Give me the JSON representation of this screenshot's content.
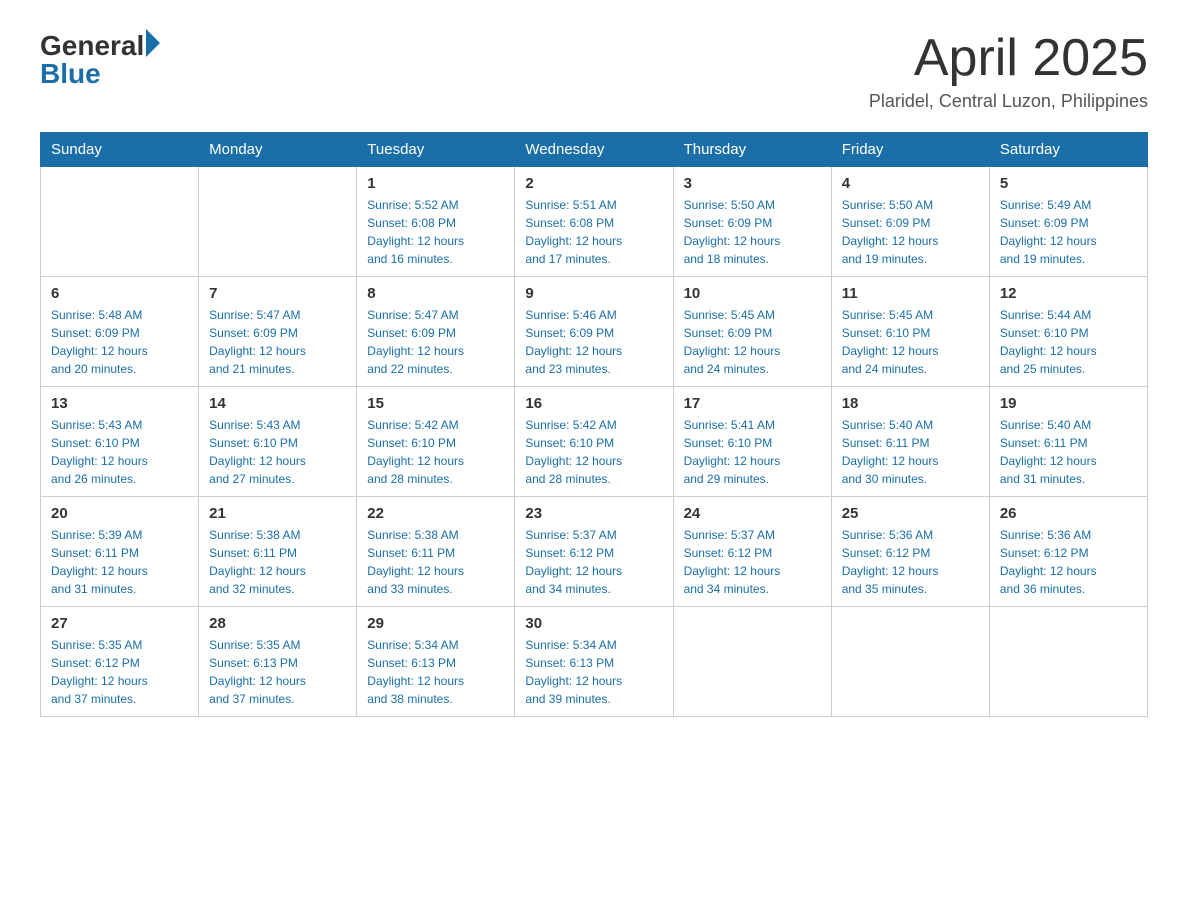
{
  "header": {
    "logo_general": "General",
    "logo_blue": "Blue",
    "month_year": "April 2025",
    "location": "Plaridel, Central Luzon, Philippines"
  },
  "days_of_week": [
    "Sunday",
    "Monday",
    "Tuesday",
    "Wednesday",
    "Thursday",
    "Friday",
    "Saturday"
  ],
  "weeks": [
    [
      {
        "day": "",
        "info": ""
      },
      {
        "day": "",
        "info": ""
      },
      {
        "day": "1",
        "info": "Sunrise: 5:52 AM\nSunset: 6:08 PM\nDaylight: 12 hours\nand 16 minutes."
      },
      {
        "day": "2",
        "info": "Sunrise: 5:51 AM\nSunset: 6:08 PM\nDaylight: 12 hours\nand 17 minutes."
      },
      {
        "day": "3",
        "info": "Sunrise: 5:50 AM\nSunset: 6:09 PM\nDaylight: 12 hours\nand 18 minutes."
      },
      {
        "day": "4",
        "info": "Sunrise: 5:50 AM\nSunset: 6:09 PM\nDaylight: 12 hours\nand 19 minutes."
      },
      {
        "day": "5",
        "info": "Sunrise: 5:49 AM\nSunset: 6:09 PM\nDaylight: 12 hours\nand 19 minutes."
      }
    ],
    [
      {
        "day": "6",
        "info": "Sunrise: 5:48 AM\nSunset: 6:09 PM\nDaylight: 12 hours\nand 20 minutes."
      },
      {
        "day": "7",
        "info": "Sunrise: 5:47 AM\nSunset: 6:09 PM\nDaylight: 12 hours\nand 21 minutes."
      },
      {
        "day": "8",
        "info": "Sunrise: 5:47 AM\nSunset: 6:09 PM\nDaylight: 12 hours\nand 22 minutes."
      },
      {
        "day": "9",
        "info": "Sunrise: 5:46 AM\nSunset: 6:09 PM\nDaylight: 12 hours\nand 23 minutes."
      },
      {
        "day": "10",
        "info": "Sunrise: 5:45 AM\nSunset: 6:09 PM\nDaylight: 12 hours\nand 24 minutes."
      },
      {
        "day": "11",
        "info": "Sunrise: 5:45 AM\nSunset: 6:10 PM\nDaylight: 12 hours\nand 24 minutes."
      },
      {
        "day": "12",
        "info": "Sunrise: 5:44 AM\nSunset: 6:10 PM\nDaylight: 12 hours\nand 25 minutes."
      }
    ],
    [
      {
        "day": "13",
        "info": "Sunrise: 5:43 AM\nSunset: 6:10 PM\nDaylight: 12 hours\nand 26 minutes."
      },
      {
        "day": "14",
        "info": "Sunrise: 5:43 AM\nSunset: 6:10 PM\nDaylight: 12 hours\nand 27 minutes."
      },
      {
        "day": "15",
        "info": "Sunrise: 5:42 AM\nSunset: 6:10 PM\nDaylight: 12 hours\nand 28 minutes."
      },
      {
        "day": "16",
        "info": "Sunrise: 5:42 AM\nSunset: 6:10 PM\nDaylight: 12 hours\nand 28 minutes."
      },
      {
        "day": "17",
        "info": "Sunrise: 5:41 AM\nSunset: 6:10 PM\nDaylight: 12 hours\nand 29 minutes."
      },
      {
        "day": "18",
        "info": "Sunrise: 5:40 AM\nSunset: 6:11 PM\nDaylight: 12 hours\nand 30 minutes."
      },
      {
        "day": "19",
        "info": "Sunrise: 5:40 AM\nSunset: 6:11 PM\nDaylight: 12 hours\nand 31 minutes."
      }
    ],
    [
      {
        "day": "20",
        "info": "Sunrise: 5:39 AM\nSunset: 6:11 PM\nDaylight: 12 hours\nand 31 minutes."
      },
      {
        "day": "21",
        "info": "Sunrise: 5:38 AM\nSunset: 6:11 PM\nDaylight: 12 hours\nand 32 minutes."
      },
      {
        "day": "22",
        "info": "Sunrise: 5:38 AM\nSunset: 6:11 PM\nDaylight: 12 hours\nand 33 minutes."
      },
      {
        "day": "23",
        "info": "Sunrise: 5:37 AM\nSunset: 6:12 PM\nDaylight: 12 hours\nand 34 minutes."
      },
      {
        "day": "24",
        "info": "Sunrise: 5:37 AM\nSunset: 6:12 PM\nDaylight: 12 hours\nand 34 minutes."
      },
      {
        "day": "25",
        "info": "Sunrise: 5:36 AM\nSunset: 6:12 PM\nDaylight: 12 hours\nand 35 minutes."
      },
      {
        "day": "26",
        "info": "Sunrise: 5:36 AM\nSunset: 6:12 PM\nDaylight: 12 hours\nand 36 minutes."
      }
    ],
    [
      {
        "day": "27",
        "info": "Sunrise: 5:35 AM\nSunset: 6:12 PM\nDaylight: 12 hours\nand 37 minutes."
      },
      {
        "day": "28",
        "info": "Sunrise: 5:35 AM\nSunset: 6:13 PM\nDaylight: 12 hours\nand 37 minutes."
      },
      {
        "day": "29",
        "info": "Sunrise: 5:34 AM\nSunset: 6:13 PM\nDaylight: 12 hours\nand 38 minutes."
      },
      {
        "day": "30",
        "info": "Sunrise: 5:34 AM\nSunset: 6:13 PM\nDaylight: 12 hours\nand 39 minutes."
      },
      {
        "day": "",
        "info": ""
      },
      {
        "day": "",
        "info": ""
      },
      {
        "day": "",
        "info": ""
      }
    ]
  ]
}
